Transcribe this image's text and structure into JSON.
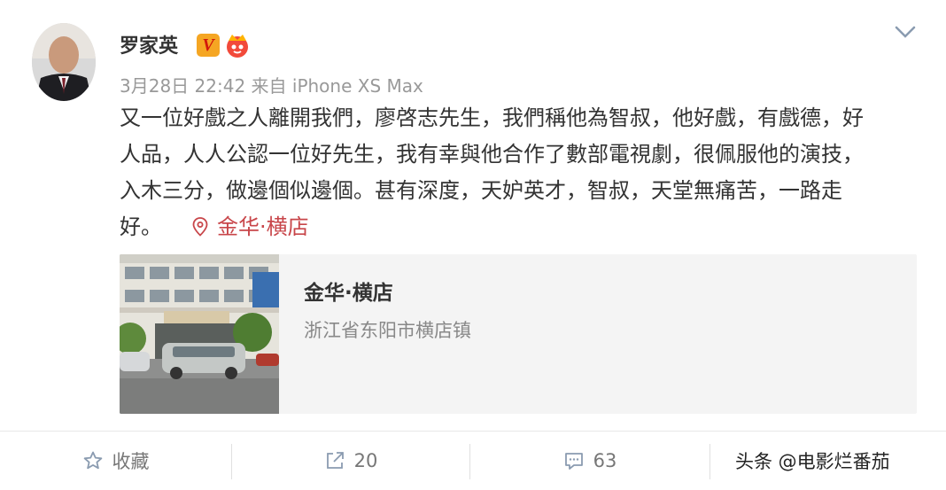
{
  "post": {
    "author": "罗家英",
    "timestamp": "3月28日 22:42",
    "source": "来自 iPhone XS Max",
    "content_lines": [
      "又一位好戲之人離開我們，廖啓志先生，我們稱他為智叔，他好戲，有戲德，好",
      "人品，人人公認一位好先生，我有幸與他合作了數部電視劇，很佩服他的演技，",
      "入木三分，做邊個似邊個。甚有深度，天妒英才，智叔，天堂無痛苦，一路走",
      "好。"
    ],
    "location_tag": "金华·横店"
  },
  "location_card": {
    "title": "金华·横店",
    "address": "浙江省东阳市横店镇"
  },
  "actions": {
    "favorite_label": "收藏",
    "repost_count": "20",
    "comment_count": "63"
  },
  "watermark": "头条 @电影烂番茄",
  "colors": {
    "location_red": "#c8464a",
    "meta_gray": "#999999",
    "badge_orange": "#f5a623"
  },
  "icons": [
    "verified-v-icon",
    "crown-badge-icon",
    "chevron-down-icon",
    "location-pin-icon",
    "star-icon",
    "repost-icon",
    "comment-icon"
  ]
}
